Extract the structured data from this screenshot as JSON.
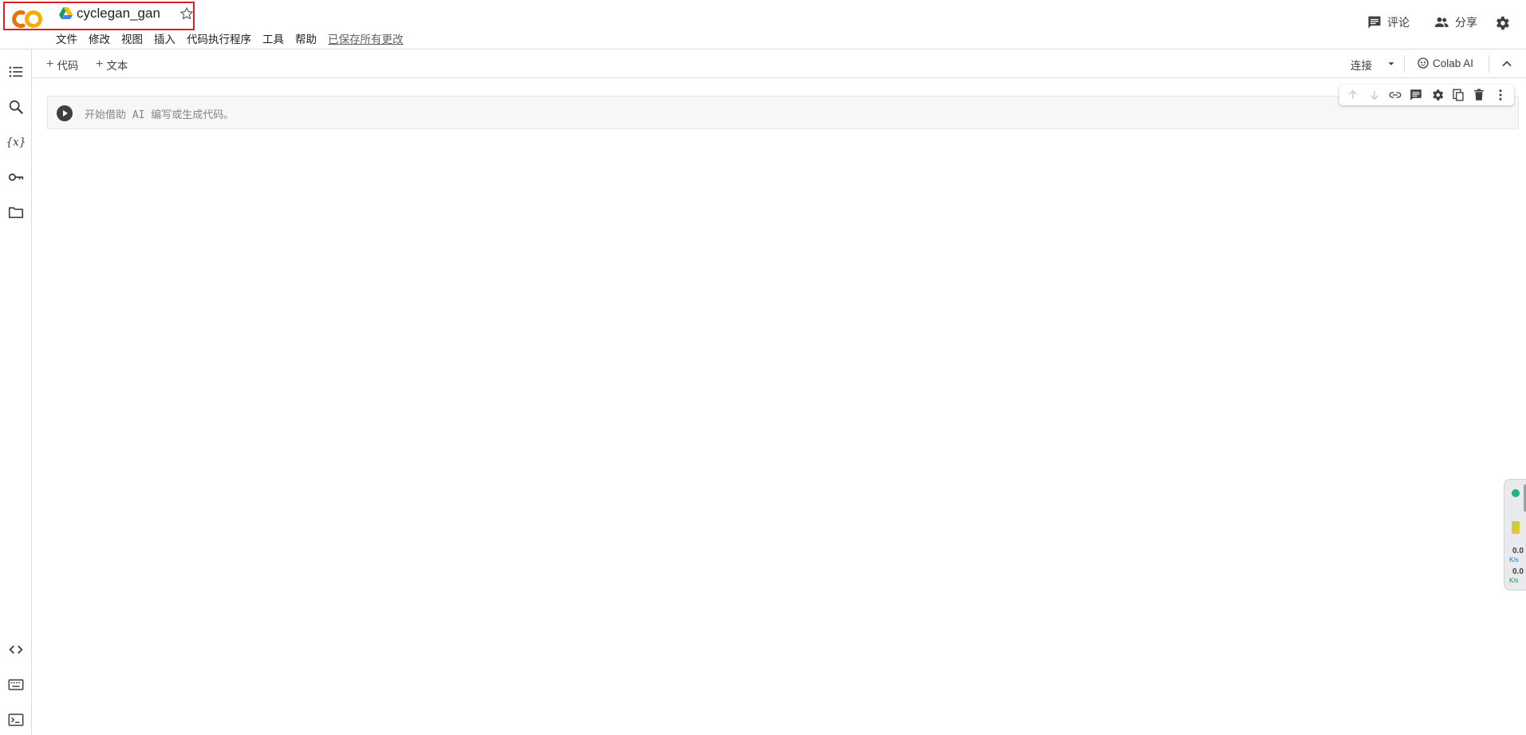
{
  "header": {
    "notebook_title": "cyclegan_gan",
    "menu": [
      "文件",
      "修改",
      "视图",
      "插入",
      "代码执行程序",
      "工具",
      "帮助"
    ],
    "saved_status": "已保存所有更改",
    "comment_label": "评论",
    "share_label": "分享"
  },
  "toolbar": {
    "add_code_label": "代码",
    "add_text_label": "文本",
    "connect_label": "连接",
    "colab_ai_label": "Colab AI"
  },
  "cell": {
    "placeholder": "开始借助 AI 编写或生成代码。"
  },
  "resources": {
    "value_1": "0.0",
    "unit_1": "K/s",
    "value_2": "0.0",
    "unit_2": "K/s"
  },
  "colors": {
    "logo_orange": "#F9AB00",
    "logo_dark_orange": "#E8710A",
    "icon_grey": "#5f6368",
    "highlight_red": "#e02020",
    "status_green": "#1fb47a"
  }
}
